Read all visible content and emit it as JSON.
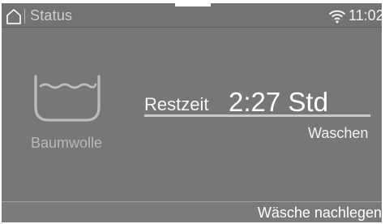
{
  "status_bar": {
    "title": "Status",
    "time": "11:02",
    "home_icon": "home-icon",
    "wifi_icon": "wifi-icon"
  },
  "program": {
    "icon": "washtub-icon",
    "name": "Baumwolle"
  },
  "remaining": {
    "label": "Restzeit",
    "value": "2:27 Std",
    "progress_fraction": 0
  },
  "phase": "Waschen",
  "footer": {
    "action": "Wäsche nachlegen"
  },
  "colors": {
    "background": "#777777",
    "text": "#ffffff",
    "muted_text": "#b8b8b8"
  }
}
